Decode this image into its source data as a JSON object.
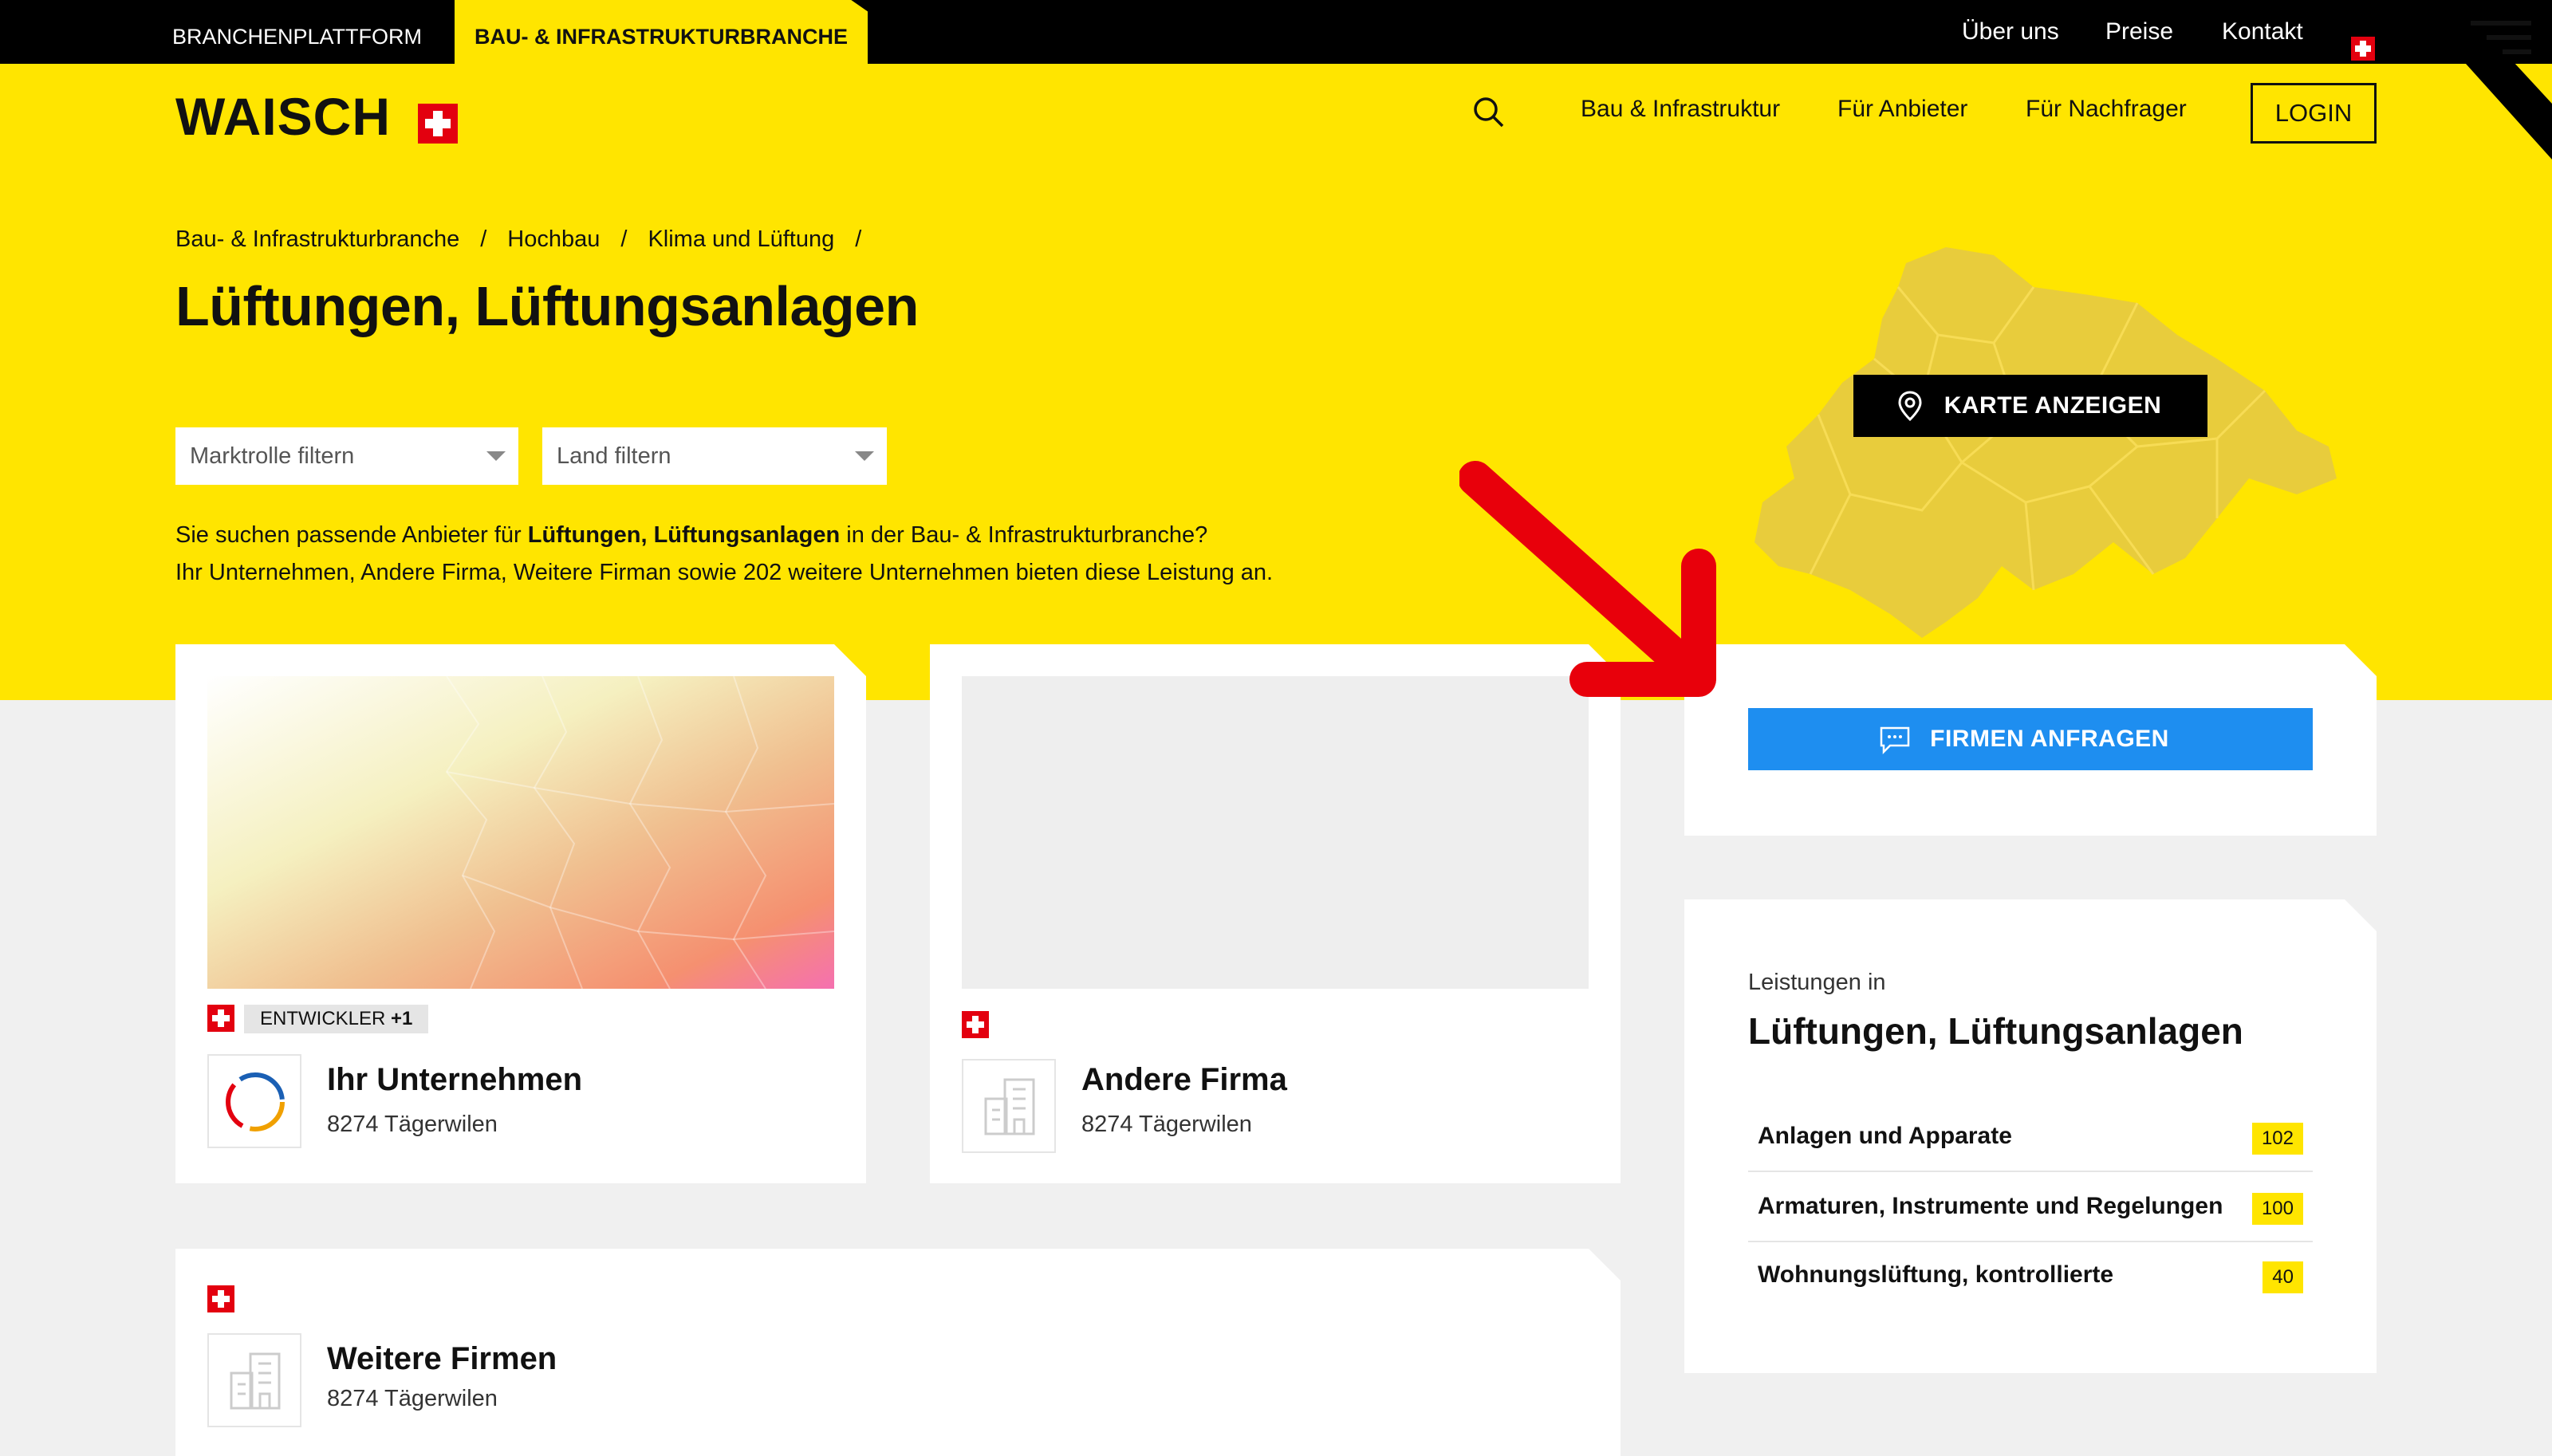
{
  "topbar": {
    "tab_platform": "BRANCHENPLATTFORM",
    "tab_active": "BAU- & INFRASTRUKTURBRANCHE",
    "links": [
      "Über uns",
      "Preise",
      "Kontakt"
    ]
  },
  "header": {
    "logo_text": "WAISCH",
    "nav": [
      "Bau & Infrastruktur",
      "Für Anbieter",
      "Für Nachfrager"
    ],
    "login": "LOGIN",
    "search_icon": "search-icon",
    "menu_icon": "hamburger-menu-icon"
  },
  "breadcrumb": [
    "Bau- & Infrastrukturbranche",
    "Hochbau",
    "Klima und Lüftung"
  ],
  "breadcrumb_sep": "/",
  "page_title": "Lüftungen, Lüftungsanlagen",
  "filters": {
    "marktrolle_placeholder": "Marktrolle filtern",
    "land_placeholder": "Land filtern"
  },
  "intro": {
    "line1_pre": "Sie suchen passende Anbieter für ",
    "line1_bold": "Lüftungen, Lüftungsanlagen",
    "line1_post": " in der Bau- & Infrastrukturbranche?",
    "line2": "Ihr Unternehmen, Andere Firma, Weitere Firman sowie 202 weitere Unternehmen bieten diese Leistung an."
  },
  "map_button": "KARTE ANZEIGEN",
  "companies": [
    {
      "name": "Ihr Unternehmen",
      "address": "8274 Tägerwilen",
      "badge": "ENTWICKLER",
      "badge_extra": "+1"
    },
    {
      "name": "Andere Firma",
      "address": "8274 Tägerwilen"
    },
    {
      "name": "Weitere Firmen",
      "address": "8274 Tägerwilen"
    }
  ],
  "request_button": "FIRMEN ANFRAGEN",
  "services": {
    "label": "Leistungen in",
    "title": "Lüftungen, Lüftungsanlagen",
    "items": [
      {
        "label": "Anlagen und Apparate",
        "count": "102"
      },
      {
        "label": "Armaturen, Instrumente und Regelungen",
        "count": "100"
      },
      {
        "label": "Wohnungslüftung, kontrollierte",
        "count": "40"
      }
    ]
  },
  "colors": {
    "accent_yellow": "#ffe500",
    "button_blue": "#1e8ef0",
    "swiss_red": "#e3000f",
    "arrow_red": "#e8000b"
  }
}
